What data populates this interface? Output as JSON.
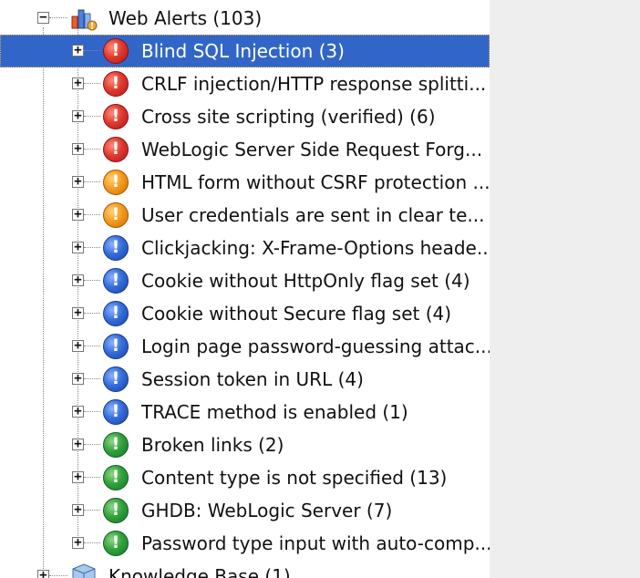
{
  "tree": {
    "root": {
      "label": "Web Alerts (103)",
      "toggle": "−",
      "icon": "web-alerts-folder-icon"
    },
    "items": [
      {
        "label": "Blind SQL Injection (3)",
        "severity": "high",
        "selected": true
      },
      {
        "label": "CRLF injection/HTTP response splitti...",
        "severity": "high"
      },
      {
        "label": "Cross site scripting (verified) (6)",
        "severity": "high"
      },
      {
        "label": "WebLogic Server Side Request Forg...",
        "severity": "high"
      },
      {
        "label": "HTML form without CSRF protection ...",
        "severity": "medium"
      },
      {
        "label": "User credentials are sent in clear te...",
        "severity": "medium"
      },
      {
        "label": "Clickjacking: X-Frame-Options heade...",
        "severity": "low"
      },
      {
        "label": "Cookie without HttpOnly flag set (4)",
        "severity": "low"
      },
      {
        "label": "Cookie without Secure flag set (4)",
        "severity": "low"
      },
      {
        "label": "Login page password-guessing attac...",
        "severity": "low"
      },
      {
        "label": "Session token in URL (4)",
        "severity": "low"
      },
      {
        "label": "TRACE method is enabled (1)",
        "severity": "low"
      },
      {
        "label": "Broken links (2)",
        "severity": "info"
      },
      {
        "label": "Content type is not specified (13)",
        "severity": "info"
      },
      {
        "label": "GHDB: WebLogic Server  (7)",
        "severity": "info"
      },
      {
        "label": "Password type input with auto-comp...",
        "severity": "info"
      }
    ],
    "next_root": {
      "label": "Knowledge Base (1)",
      "toggle": "+",
      "icon": "knowledge-base-icon"
    },
    "expand_symbol": "+",
    "alert_glyph": "!"
  },
  "colors": {
    "selection": "#3166c8",
    "high": "#e03a2d",
    "medium": "#f39c1f",
    "low": "#356edb",
    "info": "#32a33a"
  }
}
